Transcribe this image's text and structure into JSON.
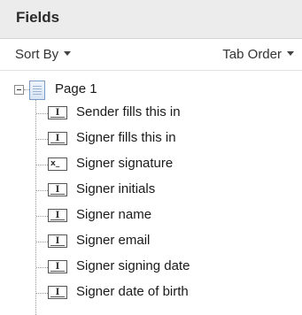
{
  "panel": {
    "title": "Fields"
  },
  "sortbar": {
    "sort_by_label": "Sort By",
    "tab_order_label": "Tab Order"
  },
  "tree": {
    "page": {
      "label": "Page 1",
      "expanded": true
    },
    "fields": [
      {
        "label": "Sender fills this in",
        "icon": "text-field-icon"
      },
      {
        "label": "Signer fills this in",
        "icon": "text-field-icon"
      },
      {
        "label": "Signer signature",
        "icon": "signature-field-icon"
      },
      {
        "label": "Signer initials",
        "icon": "text-field-icon"
      },
      {
        "label": "Signer name",
        "icon": "text-field-icon"
      },
      {
        "label": "Signer email",
        "icon": "text-field-icon"
      },
      {
        "label": "Signer signing date",
        "icon": "text-field-icon"
      },
      {
        "label": "Signer date of birth",
        "icon": "text-field-icon"
      }
    ]
  },
  "colors": {
    "header_bg": "#ececec",
    "page_icon": "#7d9cc4"
  }
}
